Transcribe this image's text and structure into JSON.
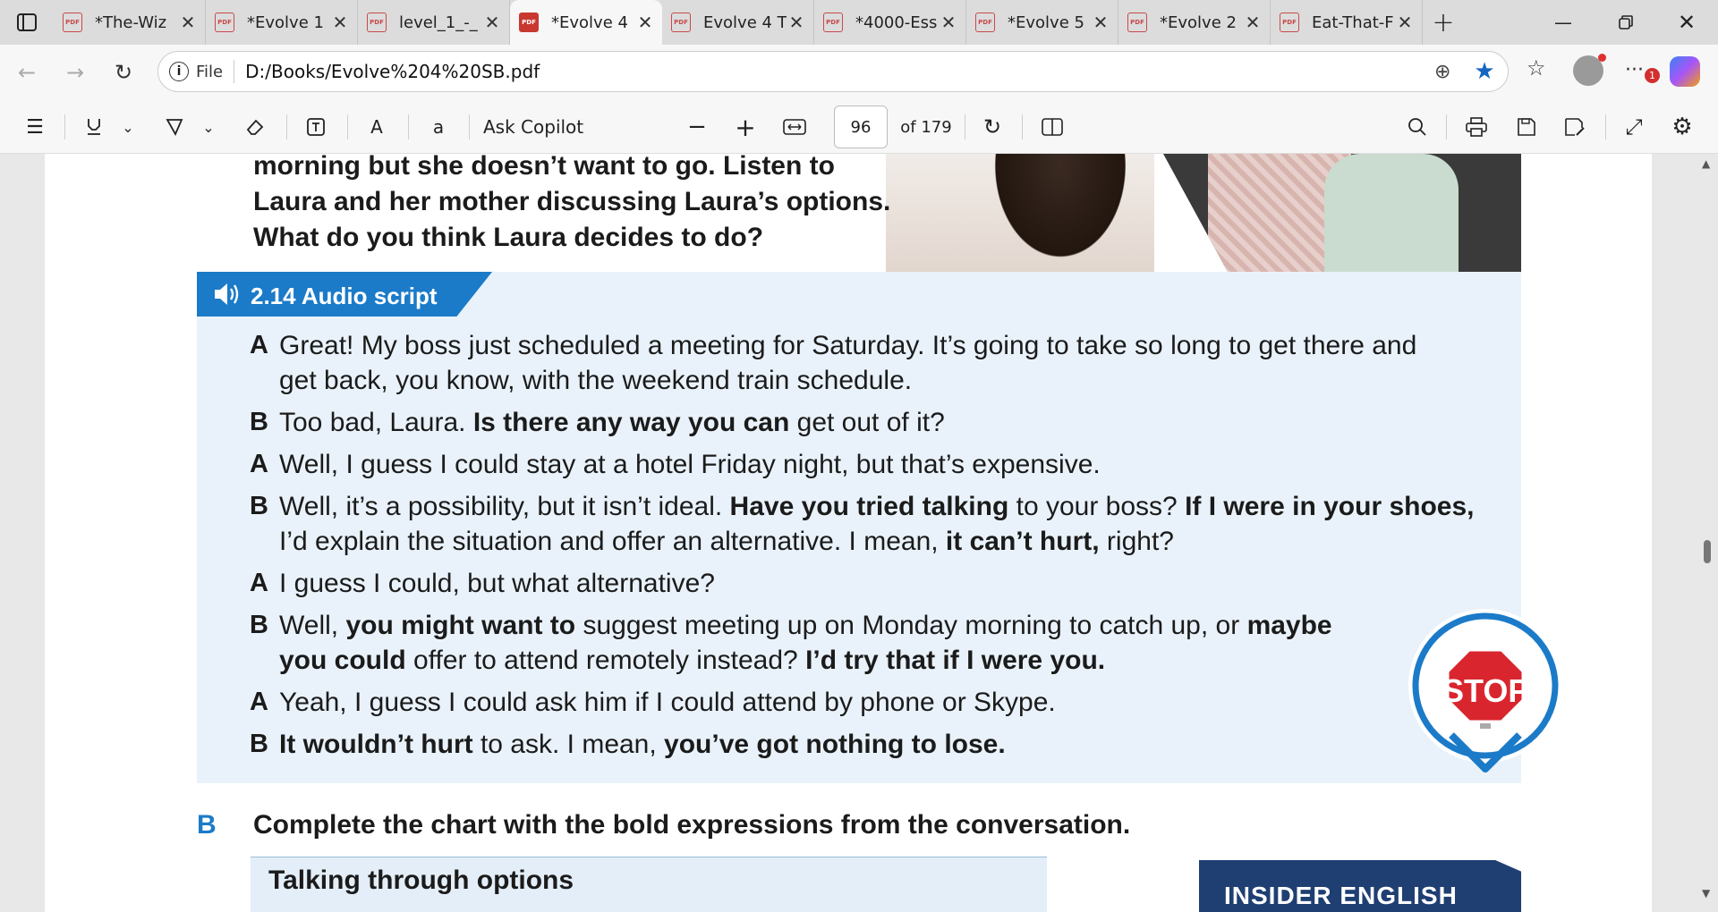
{
  "tabs": [
    {
      "label": "*The-Wiz",
      "active": false
    },
    {
      "label": "*Evolve 1",
      "active": false
    },
    {
      "label": "level_1_-_",
      "active": false
    },
    {
      "label": "*Evolve 4",
      "active": true
    },
    {
      "label": "Evolve 4 T",
      "active": false
    },
    {
      "label": "*4000-Ess",
      "active": false
    },
    {
      "label": "*Evolve 5",
      "active": false
    },
    {
      "label": "*Evolve 2",
      "active": false
    },
    {
      "label": "Eat-That-F",
      "active": false
    }
  ],
  "tab_icon": "PDF",
  "address": {
    "file_label": "File",
    "url": "D:/Books/Evolve%204%20SB.pdf"
  },
  "pdf_toolbar": {
    "ask_copilot": "Ask Copilot",
    "page_number": "96",
    "page_total": "of 179"
  },
  "notification_badge": "1",
  "document": {
    "intro_lines": [
      "morning but she doesn’t want to go. Listen to",
      "Laura and her mother discussing Laura’s options.",
      "What do you think Laura decides to do?"
    ],
    "audio_label": "2.14 Audio script",
    "dialogue": [
      {
        "speaker": "A",
        "lines": [
          [
            {
              "t": "Great! My boss just scheduled a meeting for Saturday. It’s going to take so long to get there and"
            }
          ],
          [
            {
              "t": "get back, you know, with the weekend train schedule."
            }
          ]
        ]
      },
      {
        "speaker": "B",
        "lines": [
          [
            {
              "t": "Too bad, Laura. "
            },
            {
              "t": "Is there any way you can",
              "b": true
            },
            {
              "t": " get out of it?"
            }
          ]
        ]
      },
      {
        "speaker": "A",
        "lines": [
          [
            {
              "t": "Well, I guess I could stay at a hotel Friday night, but that’s expensive."
            }
          ]
        ]
      },
      {
        "speaker": "B",
        "lines": [
          [
            {
              "t": "Well, it’s a possibility, but it isn’t ideal. "
            },
            {
              "t": "Have you tried talking",
              "b": true
            },
            {
              "t": " to your boss? "
            },
            {
              "t": "If I were in your shoes,",
              "b": true
            }
          ],
          [
            {
              "t": "I’d explain the situation and offer an alternative. I mean, "
            },
            {
              "t": "it can’t hurt,",
              "b": true
            },
            {
              "t": " right?"
            }
          ]
        ]
      },
      {
        "speaker": "A",
        "lines": [
          [
            {
              "t": "I guess I could, but what alternative?"
            }
          ]
        ]
      },
      {
        "speaker": "B",
        "lines": [
          [
            {
              "t": "Well, "
            },
            {
              "t": "you might want to",
              "b": true
            },
            {
              "t": " suggest meeting up on Monday morning to catch up, or "
            },
            {
              "t": "maybe",
              "b": true
            }
          ],
          [
            {
              "t": "you could",
              "b": true
            },
            {
              "t": " offer to attend remotely instead? "
            },
            {
              "t": "I’d try that if I were you.",
              "b": true
            }
          ]
        ]
      },
      {
        "speaker": "A",
        "lines": [
          [
            {
              "t": "Yeah, I guess I could ask him if I could attend by phone or Skype."
            }
          ]
        ]
      },
      {
        "speaker": "B",
        "lines": [
          [
            {
              "t": "It wouldn’t hurt",
              "b": true
            },
            {
              "t": " to ask. I mean, "
            },
            {
              "t": "you’ve got nothing to lose.",
              "b": true
            }
          ]
        ]
      }
    ],
    "stop_label": "STOP",
    "section_b": {
      "letter": "B",
      "pre": "Complete the chart with the ",
      "bold": "bold",
      "post": " expressions from the conversation."
    },
    "chart_heading": "Talking through options",
    "insider_label": "INSIDER ENGLISH"
  },
  "colors": {
    "accent_blue": "#1b7bc8",
    "audio_bg": "#e9f2fa",
    "stop_red": "#d9262e",
    "edge_blue": "#1976d2"
  }
}
